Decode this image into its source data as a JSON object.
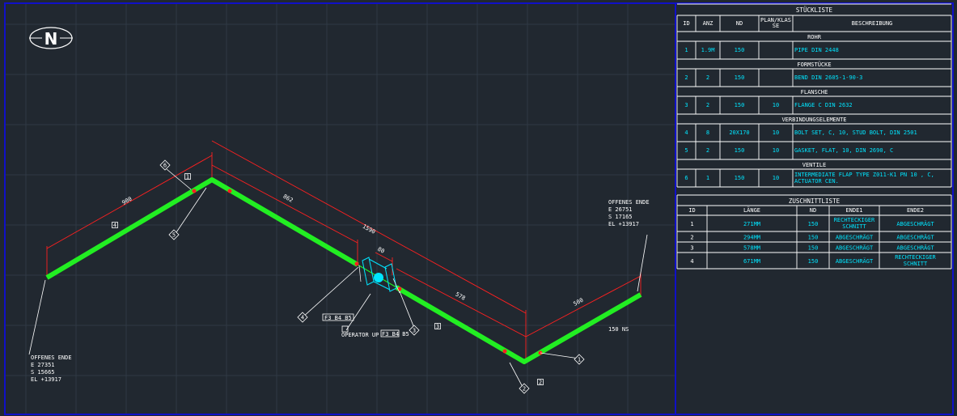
{
  "north_symbol": "N",
  "colors": {
    "background": "#212830",
    "frame": "#1010c8",
    "pipe": "#22ee22",
    "dimension": "#ff2020",
    "text": "#ffffff",
    "table_values": "#00e5ff",
    "valve": "#00e5ff"
  },
  "open_end_left": {
    "title": "OFFENES ENDE",
    "lines": [
      "E 27351",
      "S 15665",
      "EL +13917"
    ]
  },
  "open_end_right": {
    "title": "OFFENES ENDE",
    "lines": [
      "E 26751",
      "S 17165",
      "EL +13917"
    ]
  },
  "dimensions": [
    "900",
    "862",
    "1590",
    "80",
    "578",
    "500"
  ],
  "pipe_labels": [
    "150 NS"
  ],
  "balloons": [
    "6",
    "5",
    "4",
    "3",
    "2",
    "1"
  ],
  "cut_tags": [
    "1",
    "2",
    "3",
    "4"
  ],
  "tags": [
    "F3 B4 B5",
    "F3 B4 B5"
  ],
  "operator_label": "OPERATOR UP",
  "stueckliste": {
    "title": "STÜCKLISTE",
    "headers": [
      "ID",
      "ANZ",
      "ND",
      "PLAN/KLAS SE",
      "BESCHREIBUNG"
    ],
    "groups": [
      {
        "name": "ROHR",
        "rows": [
          [
            "1",
            "1.9M",
            "150",
            "",
            "PIPE DIN 2448"
          ]
        ]
      },
      {
        "name": "FORMSTÜCKE",
        "rows": [
          [
            "2",
            "2",
            "150",
            "",
            "BEND DIN 2605-1-90-3"
          ]
        ]
      },
      {
        "name": "FLANSCHE",
        "rows": [
          [
            "3",
            "2",
            "150",
            "10",
            "FLANGE C DIN 2632"
          ]
        ]
      },
      {
        "name": "VERBINDUNGSELEMENTE",
        "rows": [
          [
            "4",
            "8",
            "20X170",
            "10",
            "BOLT SET, C, 10, STUD BOLT, DIN 2501"
          ],
          [
            "5",
            "2",
            "150",
            "10",
            "GASKET, FLAT, 10, DIN 2690, C"
          ]
        ]
      },
      {
        "name": "VENTILE",
        "rows": [
          [
            "6",
            "1",
            "150",
            "10",
            "INTERMEDIATE FLAP TYPE Z011-K1 PN 10 , C, ACTUATOR CEN."
          ]
        ]
      }
    ]
  },
  "zuschnittliste": {
    "title": "ZUSCHNITTLISTE",
    "headers": [
      "ID",
      "LÄNGE",
      "ND",
      "ENDE1",
      "ENDE2"
    ],
    "rows": [
      [
        "1",
        "271MM",
        "150",
        "RECHTECKIGER SCHNITT",
        "ABGESCHRÄGT"
      ],
      [
        "2",
        "294MM",
        "150",
        "ABGESCHRÄGT",
        "ABGESCHRÄGT"
      ],
      [
        "3",
        "578MM",
        "150",
        "ABGESCHRÄGT",
        "ABGESCHRÄGT"
      ],
      [
        "4",
        "671MM",
        "150",
        "ABGESCHRÄGT",
        "RECHTECKIGER SCHNITT"
      ]
    ]
  }
}
